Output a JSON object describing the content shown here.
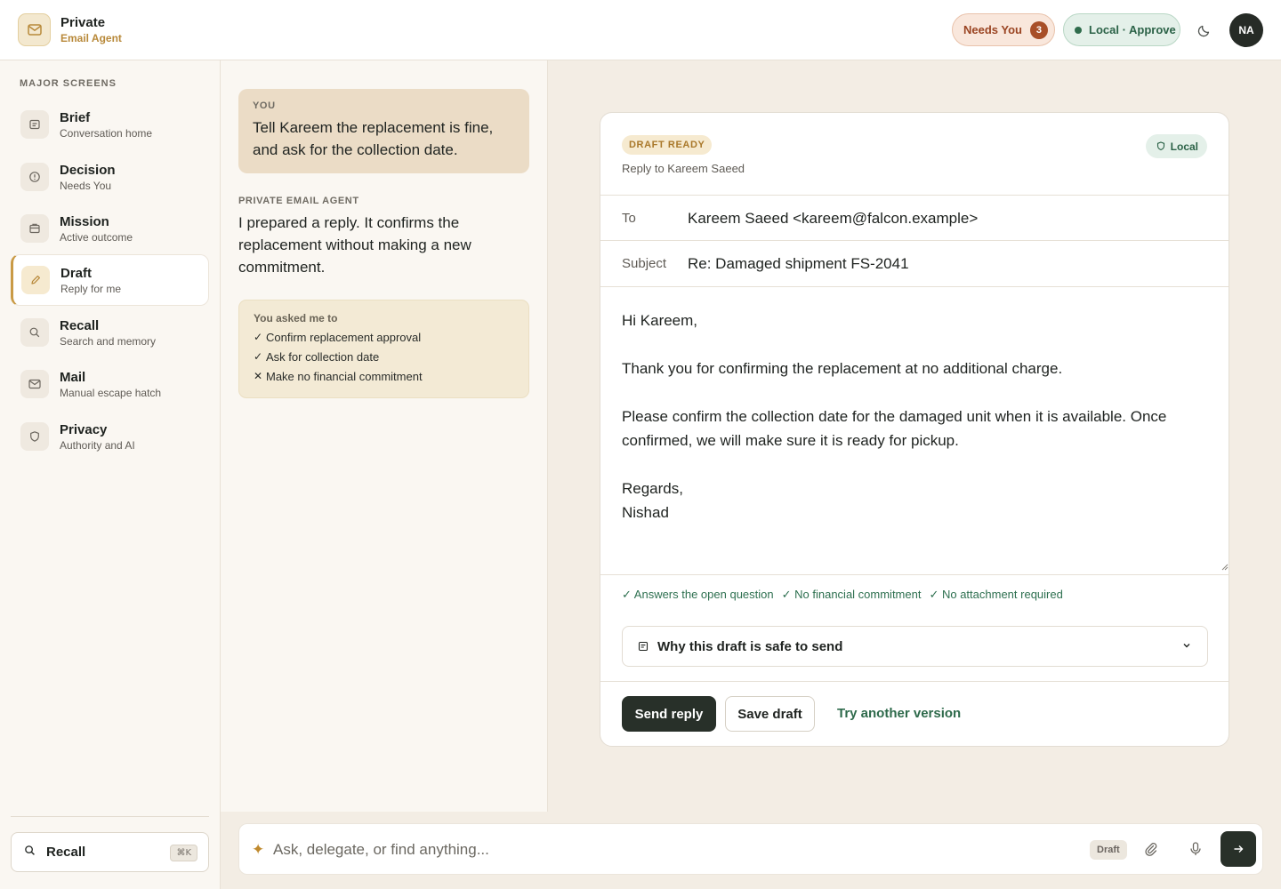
{
  "brand": {
    "name": "Private",
    "subtitle": "Email Agent"
  },
  "header": {
    "needs_you_label": "Needs You",
    "needs_you_count": "3",
    "mode_label": "Local · Approve",
    "avatar_initials": "NA"
  },
  "sidebar": {
    "heading": "MAJOR SCREENS",
    "items": [
      {
        "title": "Brief",
        "subtitle": "Conversation home",
        "icon": "brief-icon"
      },
      {
        "title": "Decision",
        "subtitle": "Needs You",
        "icon": "alert-circle-icon"
      },
      {
        "title": "Mission",
        "subtitle": "Active outcome",
        "icon": "briefcase-icon"
      },
      {
        "title": "Draft",
        "subtitle": "Reply for me",
        "icon": "pencil-icon",
        "active": true
      },
      {
        "title": "Recall",
        "subtitle": "Search and memory",
        "icon": "search-icon"
      },
      {
        "title": "Mail",
        "subtitle": "Manual escape hatch",
        "icon": "mail-icon"
      },
      {
        "title": "Privacy",
        "subtitle": "Authority and AI",
        "icon": "shield-icon"
      }
    ],
    "recall_label": "Recall",
    "recall_shortcut": "⌘K"
  },
  "conversation": {
    "you_label": "YOU",
    "you_message": "Tell Kareem the replacement is fine, and ask for the collection date.",
    "agent_label": "PRIVATE EMAIL AGENT",
    "agent_message": "I prepared a reply. It confirms the replacement without making a new commitment.",
    "asked_title": "You asked me to",
    "asked_items": [
      {
        "mark": "✓",
        "text": "Confirm replacement approval"
      },
      {
        "mark": "✓",
        "text": "Ask for collection date"
      },
      {
        "mark": "✕",
        "text": "Make no financial commitment"
      }
    ]
  },
  "draft": {
    "status_badge": "DRAFT READY",
    "reply_to": "Reply to Kareem Saeed",
    "local_badge": "Local",
    "to_label": "To",
    "to_value": "Kareem Saeed <kareem@falcon.example>",
    "subject_label": "Subject",
    "subject_value": "Re: Damaged shipment FS-2041",
    "body": {
      "greeting": "Hi Kareem,",
      "para1": "Thank you for confirming the replacement at no additional charge.",
      "para2": "Please confirm the collection date for the damaged unit when it is available. Once confirmed, we will make sure it is ready for pickup.",
      "closing": "Regards,",
      "signature": "Nishad"
    },
    "checks": [
      "✓ Answers the open question",
      "✓ No financial commitment",
      "✓ No attachment required"
    ],
    "why_label": "Why this draft is safe to send",
    "send_label": "Send reply",
    "save_label": "Save draft",
    "try_label": "Try another version"
  },
  "composer": {
    "placeholder": "Ask, delegate, or find anything...",
    "context_chip": "Draft"
  },
  "colors": {
    "accent_gold": "#c99a45",
    "accent_green": "#2e6a4b",
    "dark_button": "#283029",
    "needs_you_bg": "#f9e7dc"
  }
}
